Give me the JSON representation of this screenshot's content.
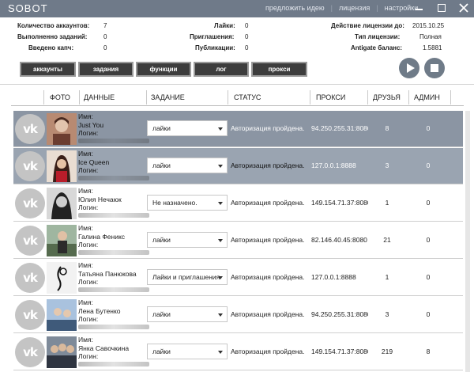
{
  "app": {
    "title": "SOBOT"
  },
  "title_links": [
    "предложить идею",
    "лицензия",
    "настройки"
  ],
  "stats": {
    "accounts_label": "Количество аккаунтов:",
    "accounts_value": "7",
    "tasks_label": "Выполненно заданий:",
    "tasks_value": "0",
    "captcha_label": "Введено капч:",
    "captcha_value": "0",
    "likes_label": "Лайки:",
    "likes_value": "0",
    "invites_label": "Приглашения:",
    "invites_value": "0",
    "posts_label": "Публикации:",
    "posts_value": "0",
    "license_until_label": "Действие лицензии до:",
    "license_until_value": "2015.10.25",
    "license_type_label": "Тип лицензии:",
    "license_type_value": "Полная",
    "antigate_label": "Antigate баланс:",
    "antigate_value": "1.5881"
  },
  "tabs": [
    "аккаунты",
    "задания",
    "функции",
    "лог",
    "прокси"
  ],
  "columns": {
    "photo": "ФОТО",
    "data": "ДАННЫЕ",
    "task": "ЗАДАНИЕ",
    "status": "СТАТУС",
    "proxy": "ПРОКСИ",
    "friends": "ДРУЗЬЯ",
    "admin": "АДМИН"
  },
  "vk_logo_text": "vk",
  "name_label": "Имя:",
  "login_label": "Логин:",
  "rows": [
    {
      "name": "Just You",
      "task": "лайки",
      "status": "Авторизация пройдена.",
      "proxy": "94.250.255.31:8080",
      "friends": "8",
      "admin": "0",
      "photo_bg": "#8a5a4a"
    },
    {
      "name": "Ice Queen",
      "task": "лайки",
      "status": "Авторизация пройдена.",
      "proxy": "127.0.0.1:8888",
      "friends": "3",
      "admin": "0",
      "photo_bg": "#c9a68a"
    },
    {
      "name": "Юлия Нечаюк",
      "task": "Не назначено.",
      "status": "Авторизация пройдена.",
      "proxy": "149.154.71.37:8080",
      "friends": "1",
      "admin": "0",
      "photo_bg": "#9b9b9b"
    },
    {
      "name": "Галина Феникс",
      "task": "лайки",
      "status": "Авторизация пройдена.",
      "proxy": "82.146.40.45:8080",
      "friends": "21",
      "admin": "0",
      "photo_bg": "#6f8f6a"
    },
    {
      "name": "Татьяна Панюкова",
      "task": "Лайки и приглашения",
      "status": "Авторизация пройдена.",
      "proxy": "127.0.0.1:8888",
      "friends": "1",
      "admin": "0",
      "photo_bg": "#e8e8e8"
    },
    {
      "name": "Лена Бутенко",
      "task": "лайки",
      "status": "Авторизация пройдена.",
      "proxy": "94.250.255.31:8080",
      "friends": "3",
      "admin": "0",
      "photo_bg": "#7b96b5"
    },
    {
      "name": "Янка Савочкина",
      "task": "лайки",
      "status": "Авторизация пройдена.",
      "proxy": "149.154.71.37:8080",
      "friends": "219",
      "admin": "8",
      "photo_bg": "#55606e"
    }
  ]
}
